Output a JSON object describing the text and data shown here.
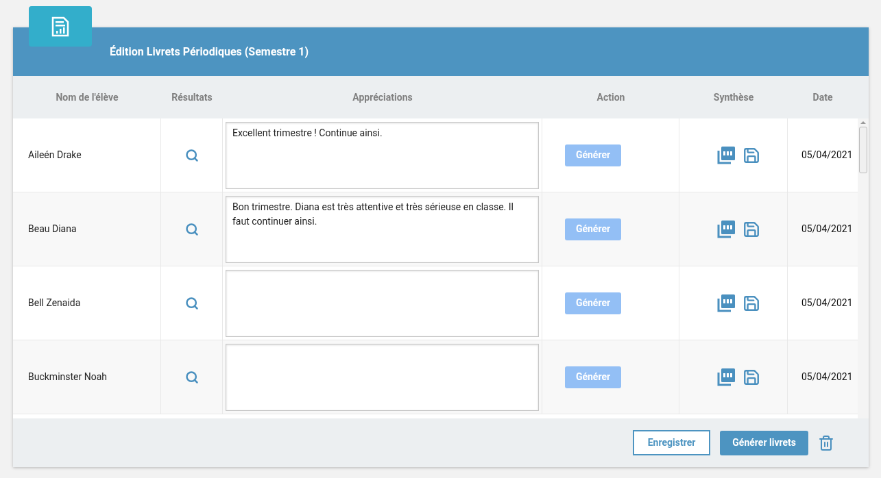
{
  "header": {
    "title": "Édition Livrets Périodiques (Semestre 1)"
  },
  "table": {
    "columns": [
      "Nom de l'élève",
      "Résultats",
      "Appréciations",
      "Action",
      "Synthèse",
      "Date"
    ],
    "rows": [
      {
        "name": "Aileén Drake",
        "comment": "Excellent trimestre ! Continue ainsi.",
        "action": "Générer",
        "action_disabled": true,
        "date": "05/04/2021"
      },
      {
        "name": "Beau Diana",
        "comment": "Bon trimestre. Diana est très attentive et très sérieuse en classe. Il faut continuer ainsi.",
        "action": "Générer",
        "action_disabled": true,
        "date": "05/04/2021"
      },
      {
        "name": "Bell Zenaida",
        "comment": "",
        "action": "Générer",
        "action_disabled": true,
        "date": "05/04/2021"
      },
      {
        "name": "Buckminster Noah",
        "comment": "",
        "action": "Générer",
        "action_disabled": true,
        "date": "05/04/2021"
      }
    ]
  },
  "footer": {
    "buttons": [
      {
        "label": "Enregistrer",
        "kind": "outline"
      },
      {
        "label": "Générer livrets",
        "kind": "primary"
      }
    ]
  }
}
